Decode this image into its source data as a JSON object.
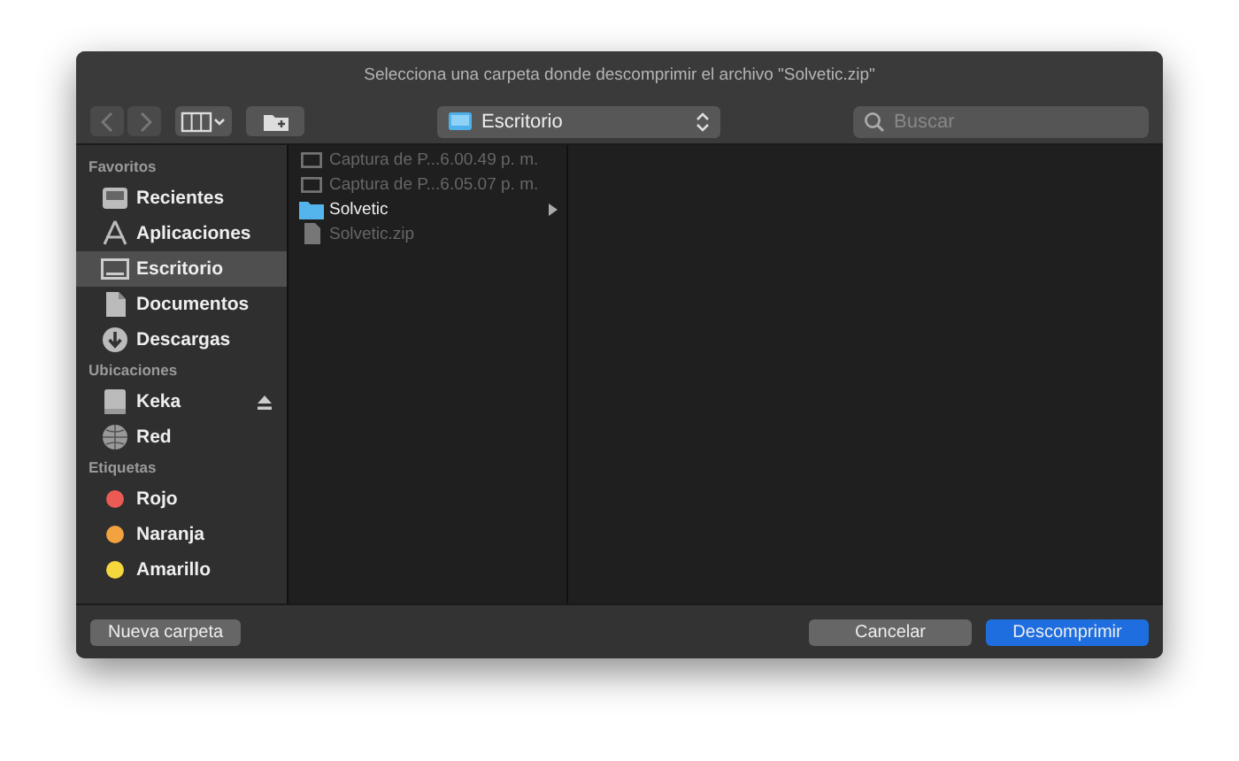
{
  "window": {
    "title": "Selecciona una carpeta donde descomprimir el archivo \"Solvetic.zip\""
  },
  "toolbar": {
    "back_disabled": true,
    "forward_disabled": true,
    "location": "Escritorio",
    "search": {
      "placeholder": "Buscar"
    }
  },
  "sidebar": {
    "sections": [
      {
        "title": "Favoritos",
        "items": [
          {
            "label": "Recientes",
            "kind": "recents",
            "selected": false
          },
          {
            "label": "Aplicaciones",
            "kind": "apps",
            "selected": false
          },
          {
            "label": "Escritorio",
            "kind": "desktop",
            "selected": true
          },
          {
            "label": "Documentos",
            "kind": "documents",
            "selected": false
          },
          {
            "label": "Descargas",
            "kind": "downloads",
            "selected": false
          }
        ]
      },
      {
        "title": "Ubicaciones",
        "items": [
          {
            "label": "Keka",
            "kind": "disk",
            "selected": false,
            "ejectable": true
          },
          {
            "label": "Red",
            "kind": "network",
            "selected": false,
            "ejectable": false
          }
        ]
      },
      {
        "title": "Etiquetas",
        "items": [
          {
            "label": "Rojo",
            "kind": "tag",
            "selected": false,
            "color": "#ec5a55"
          },
          {
            "label": "Naranja",
            "kind": "tag",
            "selected": false,
            "color": "#f2a33f"
          },
          {
            "label": "Amarillo",
            "kind": "tag",
            "selected": false,
            "color": "#f5d73e"
          }
        ]
      }
    ]
  },
  "files": [
    {
      "name": "Captura de P...6.00.49 p. m.",
      "kind": "image",
      "disabled": true,
      "has_children": false
    },
    {
      "name": "Captura de P...6.05.07 p. m.",
      "kind": "image",
      "disabled": true,
      "has_children": false
    },
    {
      "name": "Solvetic",
      "kind": "folder",
      "disabled": false,
      "has_children": true
    },
    {
      "name": "Solvetic.zip",
      "kind": "document",
      "disabled": true,
      "has_children": false
    }
  ],
  "buttons": {
    "new_folder": "Nueva carpeta",
    "cancel": "Cancelar",
    "confirm": "Descomprimir"
  }
}
